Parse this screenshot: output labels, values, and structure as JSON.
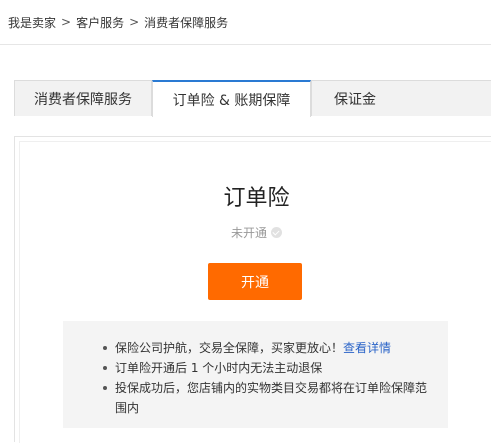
{
  "breadcrumb": {
    "items": [
      "我是卖家",
      "客户服务",
      "消费者保障服务"
    ],
    "separator": ">"
  },
  "tabs": [
    {
      "label": "消费者保障服务",
      "active": false
    },
    {
      "label": "订单险 & 账期保障",
      "active": true
    },
    {
      "label": "保证金",
      "active": false
    }
  ],
  "card": {
    "title": "订单险",
    "status": "未开通",
    "status_icon": "check-circle-icon",
    "open_button_label": "开通",
    "info": {
      "item1_text": "保险公司护航，交易全保障，买家更放心！",
      "item1_link": "查看详情",
      "item2_text": "订单险开通后 1 个小时内无法主动退保",
      "item3_text": "投保成功后，您店铺内的实物类目交易都将在订单险保障范围内"
    }
  },
  "colors": {
    "accent_orange": "#ff6a00",
    "active_tab_border": "#2a7ad3",
    "link": "#2a64c8"
  }
}
